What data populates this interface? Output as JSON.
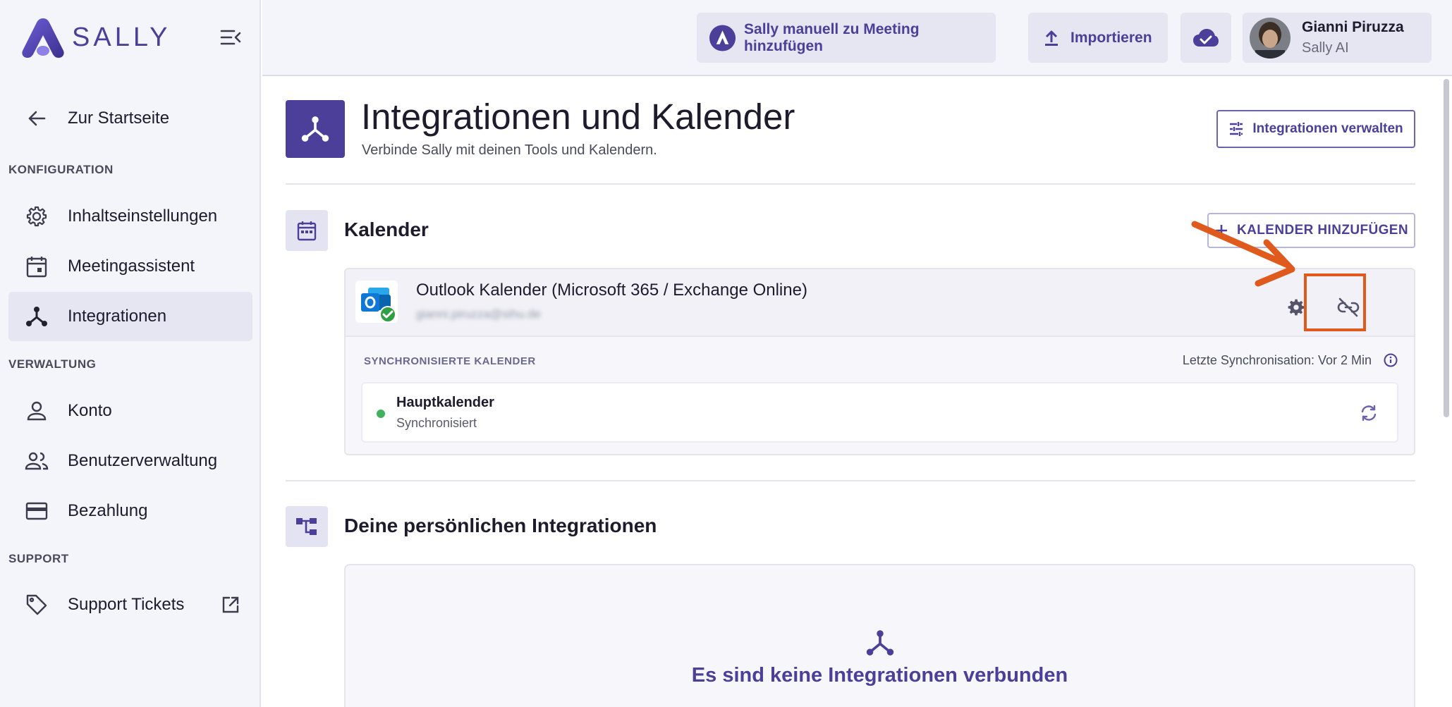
{
  "brand": {
    "name": "SALLY"
  },
  "sidebar": {
    "back_label": "Zur Startseite",
    "sections": [
      {
        "label": "KONFIGURATION",
        "items": [
          {
            "label": "Inhaltseinstellungen",
            "icon": "gear-icon"
          },
          {
            "label": "Meetingassistent",
            "icon": "calendar-icon"
          },
          {
            "label": "Integrationen",
            "icon": "integration-icon",
            "active": true
          }
        ]
      },
      {
        "label": "VERWALTUNG",
        "items": [
          {
            "label": "Konto",
            "icon": "person-icon"
          },
          {
            "label": "Benutzerverwaltung",
            "icon": "people-icon"
          },
          {
            "label": "Bezahlung",
            "icon": "credit-card-icon"
          }
        ]
      },
      {
        "label": "SUPPORT",
        "items": [
          {
            "label": "Support Tickets",
            "icon": "tag-icon",
            "external": true
          }
        ]
      }
    ]
  },
  "topbar": {
    "add_meeting_label": "Sally manuell zu Meeting hinzufügen",
    "import_label": "Importieren",
    "user": {
      "name": "Gianni Piruzza",
      "org": "Sally AI"
    }
  },
  "page": {
    "title": "Integrationen und Kalender",
    "subtitle": "Verbinde Sally mit deinen Tools und Kalendern.",
    "manage_label": "Integrationen verwalten"
  },
  "calendar_section": {
    "title": "Kalender",
    "add_label": "KALENDER HINZUFÜGEN",
    "account": {
      "name": "Outlook Kalender (Microsoft 365 / Exchange Online)",
      "email": "gianni.piruzza@sihu.de",
      "synced_label": "SYNCHRONISIERTE KALENDER",
      "last_sync": "Letzte Synchronisation: Vor 2 Min",
      "calendars": [
        {
          "name": "Hauptkalender",
          "status": "Synchronisiert"
        }
      ]
    }
  },
  "integrations_section": {
    "title": "Deine persönlichen Integrationen",
    "empty_text": "Es sind keine Integrationen verbunden"
  },
  "colors": {
    "accent": "#4b3f99",
    "annotation": "#e05a1e",
    "success": "#43b05c"
  }
}
